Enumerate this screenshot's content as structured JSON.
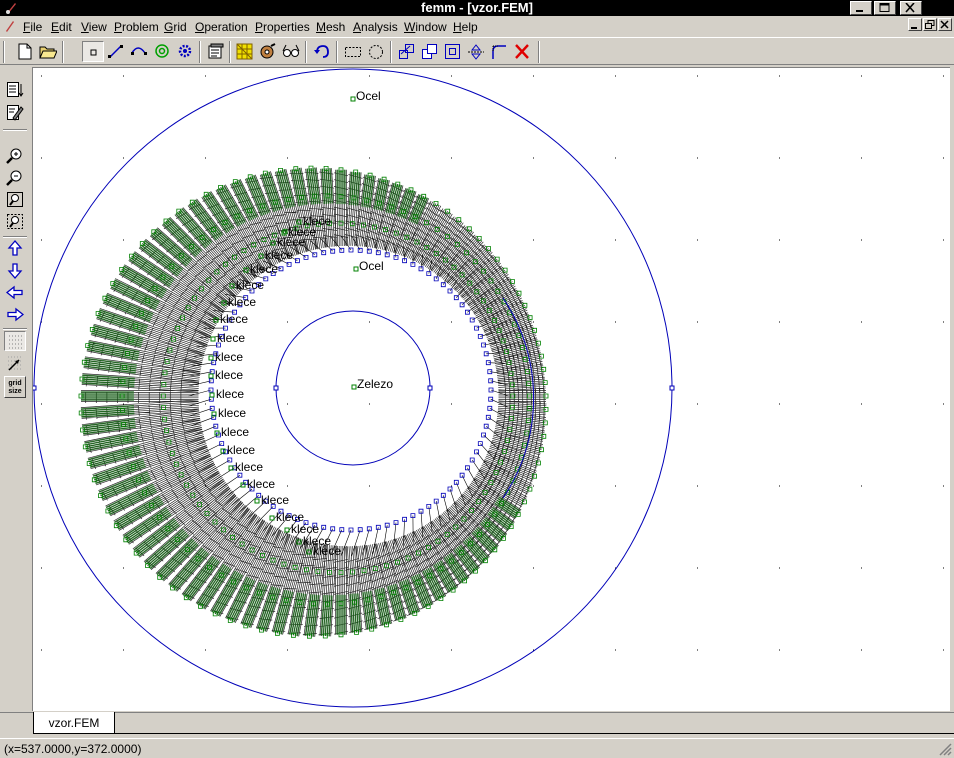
{
  "window": {
    "title": "femm - [vzor.FEM]"
  },
  "menu": [
    {
      "label": "File",
      "mnemonic": "F",
      "rest": "ile"
    },
    {
      "label": "Edit",
      "mnemonic": "E",
      "rest": "dit"
    },
    {
      "label": "View",
      "mnemonic": "V",
      "rest": "iew"
    },
    {
      "label": "Problem",
      "mnemonic": "P",
      "rest": "roblem"
    },
    {
      "label": "Grid",
      "mnemonic": "G",
      "rest": "rid"
    },
    {
      "label": "Operation",
      "mnemonic": "O",
      "rest": "peration"
    },
    {
      "label": "Properties",
      "mnemonic": "P",
      "rest": "roperties"
    },
    {
      "label": "Mesh",
      "mnemonic": "M",
      "rest": "esh"
    },
    {
      "label": "Analysis",
      "mnemonic": "A",
      "rest": "nalysis"
    },
    {
      "label": "Window",
      "mnemonic": "W",
      "rest": "indow"
    },
    {
      "label": "Help",
      "mnemonic": "H",
      "rest": "elp"
    }
  ],
  "sidebar": {
    "grid_size_line1": "grid",
    "grid_size_line2": "size"
  },
  "canvas": {
    "labels": {
      "ocel_outer": "Ocel",
      "ocel_inner": "Ocel",
      "zelezo": "Zelezo",
      "klece": "klece"
    }
  },
  "tabs": {
    "document": "vzor.FEM"
  },
  "status": {
    "coordinates": "(x=537.0000,y=372.0000)"
  },
  "colors": {
    "boundary": "#0000b8",
    "mesh_dark": "#000000",
    "mesh_green": "#146414",
    "node_green": "#008000"
  }
}
